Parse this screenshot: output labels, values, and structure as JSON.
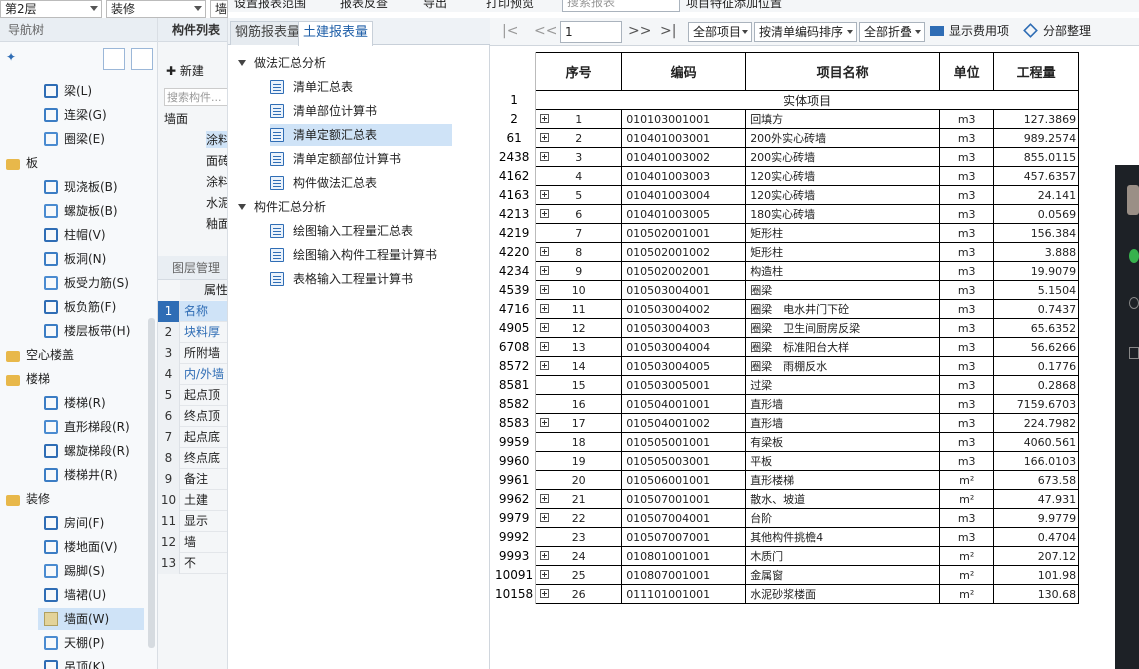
{
  "top": {
    "floor": "第2层",
    "category": "装修",
    "third": "墙",
    "buttons": [
      "设置报表范围",
      "报表反查",
      "导出",
      "打印预览"
    ],
    "search_placeholder": "搜索报表",
    "feature": "项目特征添加位置"
  },
  "nav": {
    "title": "导航树",
    "items": [
      {
        "label": "梁(L)",
        "level": 2,
        "icon": "beam-icon"
      },
      {
        "label": "连梁(G)",
        "level": 2,
        "icon": "link-beam-icon"
      },
      {
        "label": "圈梁(E)",
        "level": 2,
        "icon": "ring-beam-icon"
      },
      {
        "label": "板",
        "level": 1,
        "icon": "folder-icon"
      },
      {
        "label": "现浇板(B)",
        "level": 2,
        "icon": "slab-icon"
      },
      {
        "label": "螺旋板(B)",
        "level": 2,
        "icon": "spiral-slab-icon"
      },
      {
        "label": "柱帽(V)",
        "level": 2,
        "icon": "column-cap-icon"
      },
      {
        "label": "板洞(N)",
        "level": 2,
        "icon": "slab-hole-icon"
      },
      {
        "label": "板受力筋(S)",
        "level": 2,
        "icon": "slab-rebar-icon"
      },
      {
        "label": "板负筋(F)",
        "level": 2,
        "icon": "negative-rebar-icon"
      },
      {
        "label": "楼层板带(H)",
        "level": 2,
        "icon": "slab-strip-icon"
      },
      {
        "label": "空心楼盖",
        "level": 1,
        "icon": "folder-icon"
      },
      {
        "label": "楼梯",
        "level": 1,
        "icon": "folder-icon"
      },
      {
        "label": "楼梯(R)",
        "level": 2,
        "icon": "stair-icon"
      },
      {
        "label": "直形梯段(R)",
        "level": 2,
        "icon": "straight-stair-icon"
      },
      {
        "label": "螺旋梯段(R)",
        "level": 2,
        "icon": "spiral-stair-icon"
      },
      {
        "label": "楼梯井(R)",
        "level": 2,
        "icon": "stairwell-icon"
      },
      {
        "label": "装修",
        "level": 1,
        "icon": "folder-icon"
      },
      {
        "label": "房间(F)",
        "level": 2,
        "icon": "room-icon"
      },
      {
        "label": "楼地面(V)",
        "level": 2,
        "icon": "floor-icon"
      },
      {
        "label": "踢脚(S)",
        "level": 2,
        "icon": "skirting-icon"
      },
      {
        "label": "墙裙(U)",
        "level": 2,
        "icon": "dado-icon"
      },
      {
        "label": "墙面(W)",
        "level": 2,
        "icon": "wall-face-icon",
        "selected": true
      },
      {
        "label": "天棚(P)",
        "level": 2,
        "icon": "ceiling-icon"
      },
      {
        "label": "吊顶(K)",
        "level": 2,
        "icon": "suspended-ceiling-icon"
      }
    ]
  },
  "comp": {
    "title": "构件列表",
    "new": "新建",
    "search": "搜索构件...",
    "tree": [
      "墙面",
      "涂料",
      "面砖",
      "涂料",
      "水泥",
      "釉面"
    ],
    "layer_title": "图层管理",
    "attr": "属性",
    "rows": [
      "名称",
      "块料厚",
      "所附墙",
      "内/外墙",
      "起点顶",
      "终点顶",
      "起点底",
      "终点底",
      "备注",
      "土建",
      "显示",
      "墙",
      "不"
    ]
  },
  "report": {
    "tabs": [
      "钢筋报表量",
      "土建报表量"
    ],
    "groups": [
      {
        "label": "做法汇总分析",
        "items": [
          "清单汇总表",
          "清单部位计算书",
          "清单定额汇总表",
          "清单定额部位计算书",
          "构件做法汇总表"
        ]
      },
      {
        "label": "构件汇总分析",
        "items": [
          "绘图输入工程量汇总表",
          "绘图输入构件工程量计算书",
          "表格输入工程量计算书"
        ]
      }
    ]
  },
  "toolbar": {
    "page": "1",
    "all_items": "全部项目",
    "sort": "按清单编码排序",
    "fold": "全部折叠",
    "show_fee": "显示费用项",
    "arrange": "分部整理"
  },
  "table": {
    "headers": [
      "序号",
      "编码",
      "项目名称",
      "单位",
      "工程量"
    ],
    "section": "实体项目",
    "rows": [
      {
        "rn": "2",
        "plus": true,
        "no": "1",
        "code": "010103001001",
        "name": "回填方",
        "unit": "m3",
        "qty": "127.3869"
      },
      {
        "rn": "61",
        "plus": true,
        "no": "2",
        "code": "010401003001",
        "name": "200外实心砖墙",
        "unit": "m3",
        "qty": "989.2574"
      },
      {
        "rn": "2438",
        "plus": true,
        "no": "3",
        "code": "010401003002",
        "name": "200实心砖墙",
        "unit": "m3",
        "qty": "855.0115"
      },
      {
        "rn": "4162",
        "plus": false,
        "no": "4",
        "code": "010401003003",
        "name": "120实心砖墙",
        "unit": "m3",
        "qty": "457.6357"
      },
      {
        "rn": "4163",
        "plus": true,
        "no": "5",
        "code": "010401003004",
        "name": "120实心砖墙",
        "unit": "m3",
        "qty": "24.141"
      },
      {
        "rn": "4213",
        "plus": true,
        "no": "6",
        "code": "010401003005",
        "name": "180实心砖墙",
        "unit": "m3",
        "qty": "0.0569"
      },
      {
        "rn": "4219",
        "plus": false,
        "no": "7",
        "code": "010502001001",
        "name": "矩形柱",
        "unit": "m3",
        "qty": "156.384"
      },
      {
        "rn": "4220",
        "plus": true,
        "no": "8",
        "code": "010502001002",
        "name": "矩形柱",
        "unit": "m3",
        "qty": "3.888"
      },
      {
        "rn": "4234",
        "plus": true,
        "no": "9",
        "code": "010502002001",
        "name": "构造柱",
        "unit": "m3",
        "qty": "19.9079"
      },
      {
        "rn": "4539",
        "plus": true,
        "no": "10",
        "code": "010503004001",
        "name": "圈梁",
        "unit": "m3",
        "qty": "5.1504"
      },
      {
        "rn": "4716",
        "plus": true,
        "no": "11",
        "code": "010503004002",
        "name": "圈梁　电水井门下砼",
        "unit": "m3",
        "qty": "0.7437"
      },
      {
        "rn": "4905",
        "plus": true,
        "no": "12",
        "code": "010503004003",
        "name": "圈梁　卫生间厨房反梁",
        "unit": "m3",
        "qty": "65.6352"
      },
      {
        "rn": "6708",
        "plus": true,
        "no": "13",
        "code": "010503004004",
        "name": "圈梁　标准阳台大样",
        "unit": "m3",
        "qty": "56.6266"
      },
      {
        "rn": "8572",
        "plus": true,
        "no": "14",
        "code": "010503004005",
        "name": "圈梁　雨棚反水",
        "unit": "m3",
        "qty": "0.1776"
      },
      {
        "rn": "8581",
        "plus": false,
        "no": "15",
        "code": "010503005001",
        "name": "过梁",
        "unit": "m3",
        "qty": "0.2868"
      },
      {
        "rn": "8582",
        "plus": false,
        "no": "16",
        "code": "010504001001",
        "name": "直形墙",
        "unit": "m3",
        "qty": "7159.6703"
      },
      {
        "rn": "8583",
        "plus": true,
        "no": "17",
        "code": "010504001002",
        "name": "直形墙",
        "unit": "m3",
        "qty": "224.7982"
      },
      {
        "rn": "9959",
        "plus": false,
        "no": "18",
        "code": "010505001001",
        "name": "有梁板",
        "unit": "m3",
        "qty": "4060.561"
      },
      {
        "rn": "9960",
        "plus": false,
        "no": "19",
        "code": "010505003001",
        "name": "平板",
        "unit": "m3",
        "qty": "166.0103"
      },
      {
        "rn": "9961",
        "plus": false,
        "no": "20",
        "code": "010506001001",
        "name": "直形楼梯",
        "unit": "m²",
        "qty": "673.58"
      },
      {
        "rn": "9962",
        "plus": true,
        "no": "21",
        "code": "010507001001",
        "name": "散水、坡道",
        "unit": "m²",
        "qty": "47.931"
      },
      {
        "rn": "9979",
        "plus": true,
        "no": "22",
        "code": "010507004001",
        "name": "台阶",
        "unit": "m3",
        "qty": "9.9779"
      },
      {
        "rn": "9992",
        "plus": false,
        "no": "23",
        "code": "010507007001",
        "name": "其他构件挑檐4",
        "unit": "m3",
        "qty": "0.4704"
      },
      {
        "rn": "9993",
        "plus": true,
        "no": "24",
        "code": "010801001001",
        "name": "木质门",
        "unit": "m²",
        "qty": "207.12"
      },
      {
        "rn": "10091",
        "plus": true,
        "no": "25",
        "code": "010807001001",
        "name": "金属窗",
        "unit": "m²",
        "qty": "101.98"
      },
      {
        "rn": "10158",
        "plus": true,
        "no": "26",
        "code": "011101001001",
        "name": "水泥砂浆楼面",
        "unit": "m²",
        "qty": "130.68"
      }
    ]
  },
  "colors": {
    "accent": "#2f6db5",
    "selected": "#cfe3f7"
  }
}
